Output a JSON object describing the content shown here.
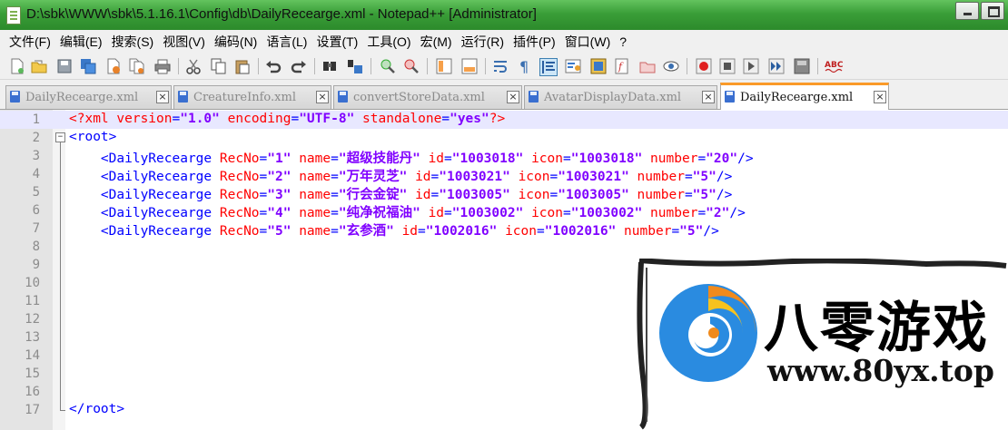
{
  "window": {
    "title": "D:\\sbk\\WWW\\sbk\\5.1.16.1\\Config\\db\\DailyRecearge.xml - Notepad++ [Administrator]"
  },
  "menu": [
    "文件(F)",
    "编辑(E)",
    "搜索(S)",
    "视图(V)",
    "编码(N)",
    "语言(L)",
    "设置(T)",
    "工具(O)",
    "宏(M)",
    "运行(R)",
    "插件(P)",
    "窗口(W)",
    "?"
  ],
  "tabs": [
    {
      "label": "DailyRecearge.xml",
      "active": false
    },
    {
      "label": "CreatureInfo.xml",
      "active": false
    },
    {
      "label": "convertStoreData.xml",
      "active": false
    },
    {
      "label": "AvatarDisplayData.xml",
      "active": false
    },
    {
      "label": "DailyRecearge.xml",
      "active": true
    }
  ],
  "editor": {
    "current_line": 1,
    "line_numbers": [
      "1",
      "2",
      "3",
      "4",
      "5",
      "6",
      "7",
      "8",
      "9",
      "10",
      "11",
      "12",
      "13",
      "14",
      "15",
      "16",
      "17"
    ],
    "xml_decl": {
      "open": "<?xml ",
      "version_attr": "version",
      "version_val": "\"1.0\"",
      "encoding_attr": "encoding",
      "encoding_val": "\"UTF-8\"",
      "standalone_attr": "standalone",
      "standalone_val": "\"yes\"",
      "close": "?>"
    },
    "root_open": "<root>",
    "root_close": "</root>",
    "element": "<DailyRecearge",
    "element_end": "/>",
    "attr_names": {
      "recno": "RecNo",
      "name": "name",
      "id": "id",
      "icon": "icon",
      "number": "number"
    },
    "records": [
      {
        "recno": "\"1\"",
        "name": "\"超级技能丹\"",
        "id": "\"1003018\"",
        "icon": "\"1003018\"",
        "number": "\"20\""
      },
      {
        "recno": "\"2\"",
        "name": "\"万年灵芝\"",
        "id": "\"1003021\"",
        "icon": "\"1003021\"",
        "number": "\"5\""
      },
      {
        "recno": "\"3\"",
        "name": "\"行会金锭\"",
        "id": "\"1003005\"",
        "icon": "\"1003005\"",
        "number": "\"5\""
      },
      {
        "recno": "\"4\"",
        "name": "\"纯净祝福油\"",
        "id": "\"1003002\"",
        "icon": "\"1003002\"",
        "number": "\"2\""
      },
      {
        "recno": "\"5\"",
        "name": "\"玄参酒\"",
        "id": "\"1002016\"",
        "icon": "\"1002016\"",
        "number": "\"5\""
      }
    ]
  },
  "watermark": {
    "brand": "八零游戏",
    "url": "www.80yx.top"
  },
  "colors": {
    "titlebar": "#3a9e38",
    "tag": "#0000ff",
    "attribute": "#ff0000",
    "value": "#8000ff",
    "current_line": "#e8e8ff",
    "active_tab_accent": "#fa9a28"
  },
  "icons": [
    "new-file-icon",
    "open-file-icon",
    "save-icon",
    "save-all-icon",
    "close-icon",
    "close-all-icon",
    "print-icon",
    "cut-icon",
    "copy-icon",
    "paste-icon",
    "undo-icon",
    "redo-icon",
    "find-icon",
    "replace-icon",
    "zoom-in-icon",
    "zoom-out-icon",
    "sync-vertical-icon",
    "sync-horizontal-icon",
    "word-wrap-icon",
    "show-all-chars-icon",
    "indent-guide-icon",
    "udl-icon",
    "doc-map-icon",
    "function-list-icon",
    "folder-workspace-icon",
    "monitor-icon",
    "record-macro-icon",
    "stop-record-icon",
    "play-macro-icon",
    "run-macro-multiple-icon",
    "save-macro-icon",
    "spellcheck-icon"
  ]
}
